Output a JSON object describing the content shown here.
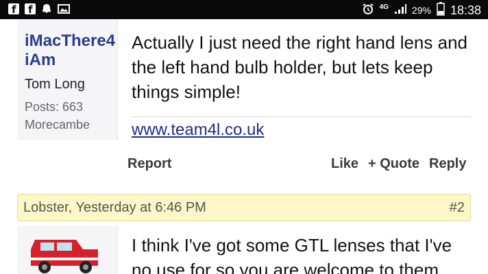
{
  "status_bar": {
    "left_icons": [
      "facebook-icon",
      "facebook-icon",
      "snapchat-ghost-icon",
      "image-icon"
    ],
    "network": "4G",
    "battery": "29%",
    "time": "18:38",
    "icons": [
      "alarm-icon",
      "signal-icon",
      "battery-icon"
    ]
  },
  "post1": {
    "username": "iMacThere4iAm",
    "real_name": "Tom Long",
    "posts": "Posts: 663",
    "location": "Morecambe",
    "message": "Actually I just need the right hand lens and the left hand bulb holder, but lets keep things simple!",
    "signature_link": "www.team4l.co.uk"
  },
  "actions": {
    "report": "Report",
    "like": "Like",
    "quote": "+ Quote",
    "reply": "Reply"
  },
  "post2": {
    "header_meta": "Lobster, Yesterday at 6:46 PM",
    "post_number": "#2",
    "message": "I think I've got some GTL lenses that I've no use for so you are welcome to them"
  },
  "colors": {
    "username": "#2a3e8a",
    "link": "#1d2d86",
    "post_header_bg": "#fcf7c6",
    "author_bg": "#f5f5f8"
  }
}
